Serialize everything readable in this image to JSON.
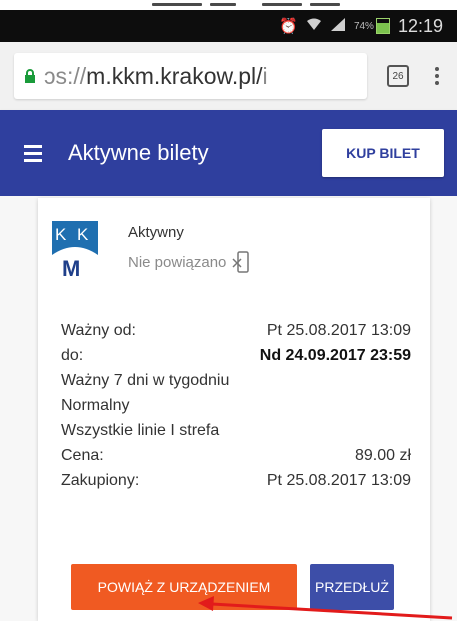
{
  "status_bar": {
    "battery_percent": "74%",
    "battery_level": 0.74,
    "time": "12:19",
    "icons": [
      "alarm-icon",
      "wifi-icon",
      "signal-icon",
      "battery-icon"
    ]
  },
  "browser": {
    "url_prefix": "ɔs://",
    "url_host": "m.kkm.krakow.pl/",
    "url_trail": "i",
    "tabs_count": "26"
  },
  "app_bar": {
    "title": "Aktywne bilety",
    "buy_button": "KUP BILET"
  },
  "ticket": {
    "status": "Aktywny",
    "link_status": "Nie powiązano",
    "valid_from_label": "Ważny od:",
    "valid_from_value": "Pt 25.08.2017 13:09",
    "valid_to_label": "do:",
    "valid_to_value": "Nd 24.09.2017 23:59",
    "days": "Ważny 7 dni w tygodniu",
    "fare_type": "Normalny",
    "zone": "Wszystkie linie I strefa",
    "price_label": "Cena:",
    "price_value": "89.00 zł",
    "purchased_label": "Zakupiony:",
    "purchased_value": "Pt 25.08.2017 13:09",
    "pair_button": "POWIĄŻ Z URZĄDZENIEM",
    "extend_button": "PRZEDŁUŻ"
  },
  "colors": {
    "app_bar": "#2f3f9e",
    "pair_button": "#f05a22",
    "extend_button": "#3d4ea8",
    "annotation_arrow": "#e21b1b"
  }
}
